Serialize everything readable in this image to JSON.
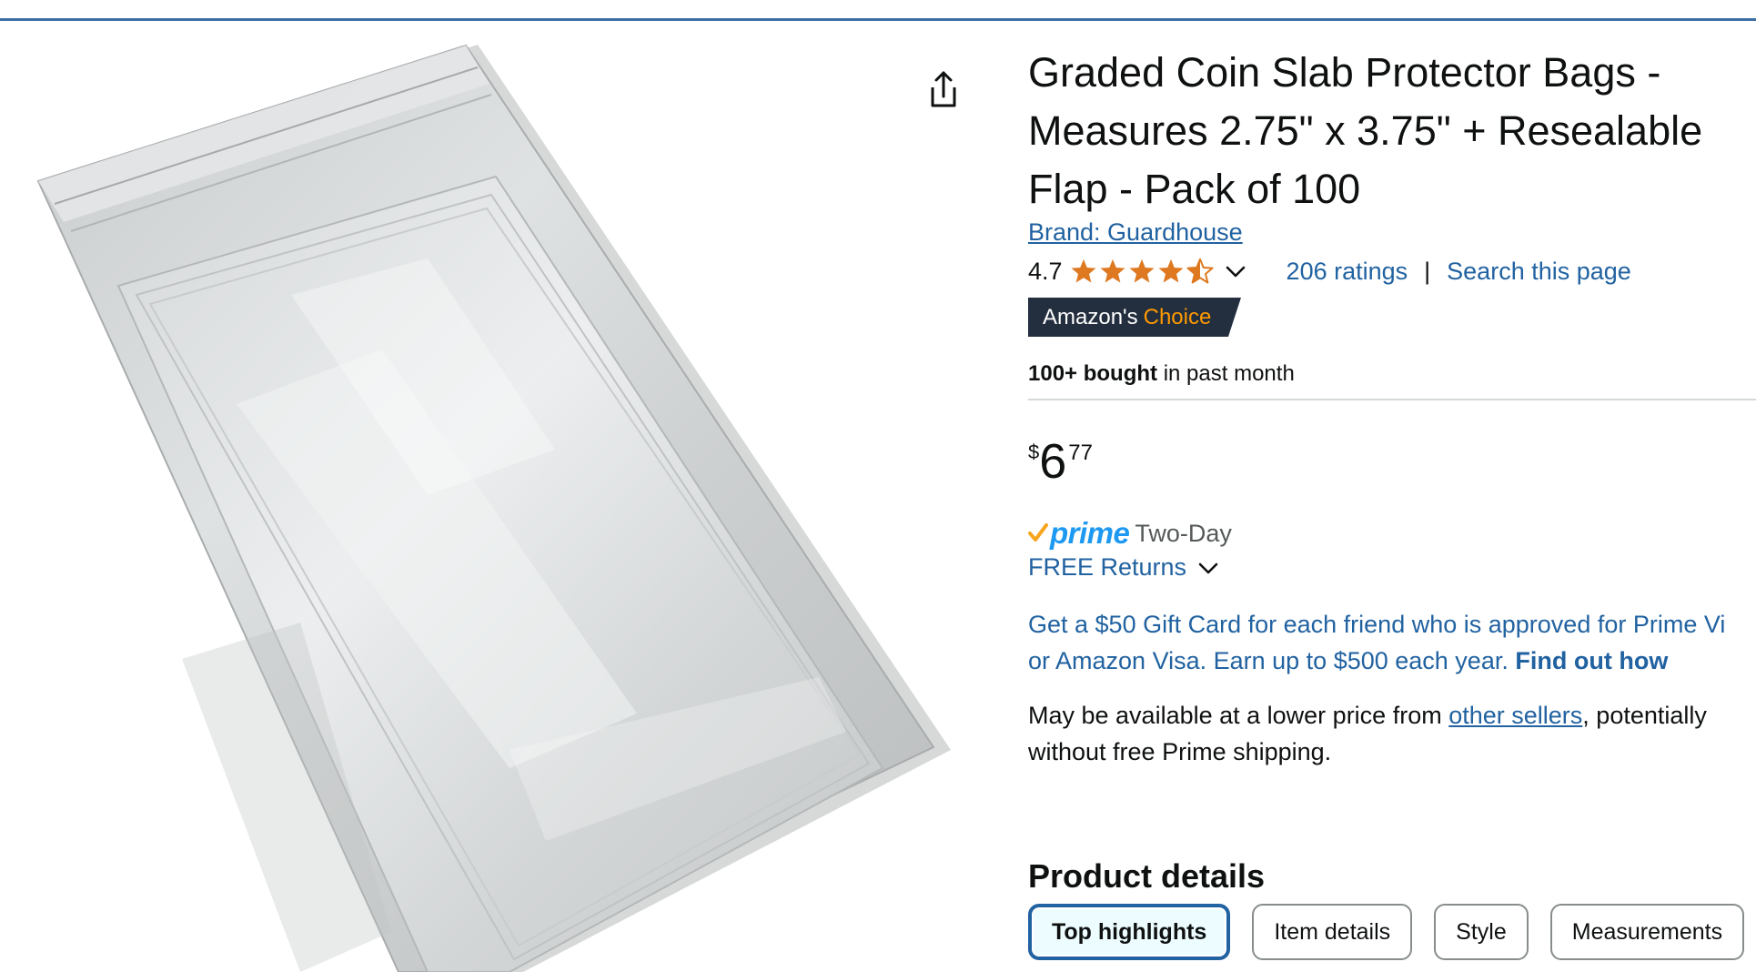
{
  "product": {
    "title_lines": [
      "Graded Coin Slab Protector Bags -",
      "Measures 2.75\" x 3.75\" + Resealable",
      "Flap - Pack of 100"
    ],
    "brand_link": "Brand: Guardhouse",
    "image_icon": "product-photo"
  },
  "share": {
    "icon": "share-icon"
  },
  "rating": {
    "value": "4.7",
    "stars_fraction": 0.94,
    "count_link": "206 ratings",
    "separator": "|",
    "search_link": "Search this page"
  },
  "badge": {
    "prefix": "Amazon's",
    "highlight": "Choice"
  },
  "bought": {
    "bold": "100+ bought",
    "rest": "in past month"
  },
  "price": {
    "symbol": "$",
    "whole": "6",
    "fraction": "77"
  },
  "delivery": {
    "prime_label": "prime",
    "prime_suffix": "Two-Day",
    "returns_label": "FREE Returns"
  },
  "promo": {
    "line1": "Get a $50 Gift Card for each friend who is approved for Prime Vi",
    "line2_text": "or Amazon Visa. Earn up to $500 each year.",
    "line2_link": "Find out how"
  },
  "availability": {
    "line1_text": "May be available at a lower price from",
    "line1_link": "other sellers",
    "line1_tail": ", potentially",
    "line2": "without free Prime shipping."
  },
  "details": {
    "heading": "Product details",
    "tabs": [
      {
        "label": "Top highlights",
        "active": true
      },
      {
        "label": "Item details",
        "active": false
      },
      {
        "label": "Style",
        "active": false
      },
      {
        "label": "Measurements",
        "active": false
      }
    ]
  },
  "colors": {
    "link": "#2162a1",
    "star": "#de7921",
    "badge_bg": "#232f3e",
    "badge_highlight": "#ff9900",
    "prime_blue": "#1d99f1",
    "prime_check": "#f7a51d"
  }
}
